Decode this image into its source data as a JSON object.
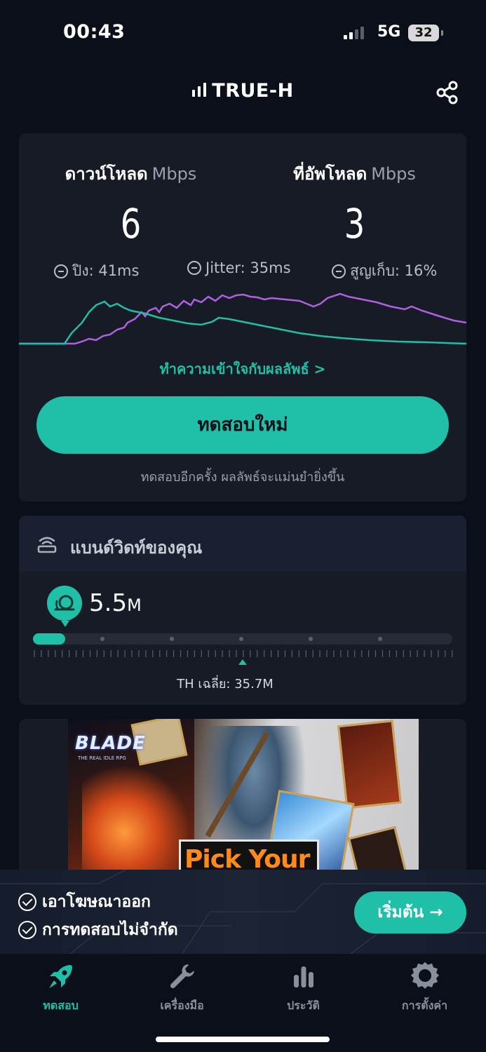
{
  "status_bar": {
    "time": "00:43",
    "network": "5G",
    "battery": "32"
  },
  "header": {
    "title": "TRUE-H"
  },
  "result": {
    "download_label": "ดาวน์โหลด",
    "upload_label": "ที่อัพโหลด",
    "unit": "Mbps",
    "download_value": "6",
    "upload_value": "3",
    "ping": "ปิง: 41ms",
    "jitter": "Jitter: 35ms",
    "loss": "สูญเก็บ: 16%",
    "understand_link": "ทำความเข้าใจกับผลลัพธ์ >",
    "retest_button": "ทดสอบใหม่",
    "retest_hint": "ทดสอบอีกครั้ง ผลลัพธ์จะแม่นยำยิ่งขึ้น",
    "colors": {
      "download": "#1fbfa8",
      "upload": "#b061e0"
    }
  },
  "bandwidth": {
    "title": "แบนด์วิดท์ของคุณ",
    "value": "5.5",
    "value_suffix": "M",
    "average_label": "TH เฉลี่ย: 35.7M",
    "level_fraction": 0.077
  },
  "ad": {
    "logo": "BLADE",
    "logo_sub": "THE REAL IDLE RPG",
    "cta": "Pick Your"
  },
  "promo": {
    "item1": "เอาโฆษณาออก",
    "item2": "การทดสอบไม่จำกัด",
    "start_button": "เริ่มต้น →"
  },
  "tabs": [
    {
      "label": "ทดสอบ",
      "icon": "rocket-icon",
      "active": true
    },
    {
      "label": "เครื่องมือ",
      "icon": "wrench-icon",
      "active": false
    },
    {
      "label": "ประวัติ",
      "icon": "bar-chart-icon",
      "active": false
    },
    {
      "label": "การตั้งค่า",
      "icon": "gear-icon",
      "active": false
    }
  ]
}
